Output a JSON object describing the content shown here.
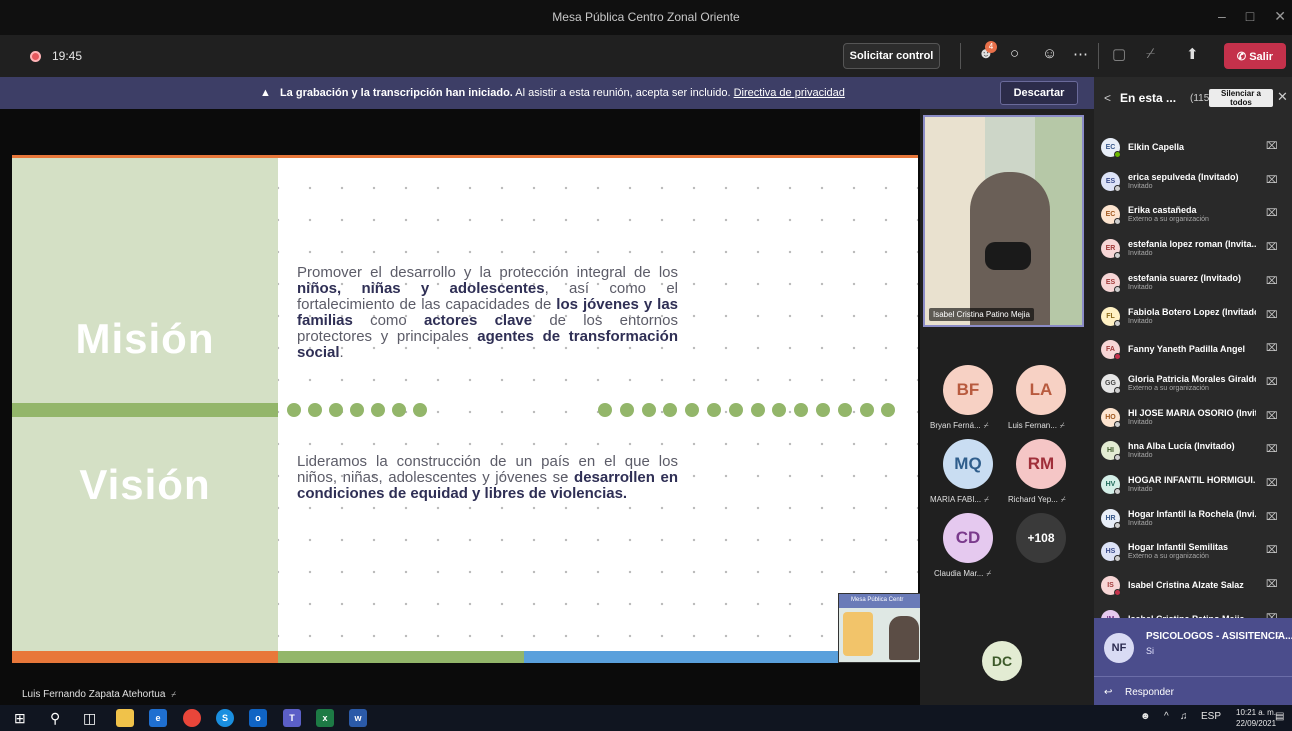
{
  "window": {
    "title": "Mesa Pública Centro Zonal Oriente",
    "controls": [
      "–",
      "□",
      "✕"
    ]
  },
  "toolbar": {
    "timer": "19:45",
    "request_control_label": "Solicitar control",
    "participants_badge": "4",
    "leave_label": "Salir",
    "icons": [
      "people-icon",
      "chat-icon",
      "reactions-icon",
      "more-icon",
      "camera-off-icon",
      "mic-off-icon",
      "share-icon",
      "phone-icon"
    ]
  },
  "banner": {
    "bold_text": "La grabación y la transcripción han iniciado.",
    "text": "Al asistir a esta reunión, acepta ser incluido.",
    "link_text": "Directiva de privacidad",
    "dismiss_label": "Descartar"
  },
  "slide": {
    "mission_title": "Misión",
    "vision_title": "Visión",
    "mission_text_segments": [
      {
        "t": "Promover el desarrollo y la protección integral de los ",
        "b": false
      },
      {
        "t": "niños, niñas y adolescentes",
        "b": true
      },
      {
        "t": ", así como el fortalecimiento de las capacidades de ",
        "b": false
      },
      {
        "t": "los jóvenes y las familias",
        "b": true
      },
      {
        "t": " como ",
        "b": false
      },
      {
        "t": "actores clave",
        "b": true
      },
      {
        "t": " de los entornos protectores y principales ",
        "b": false
      },
      {
        "t": "agentes de transformación social",
        "b": true
      },
      {
        "t": ".",
        "b": false
      }
    ],
    "vision_text_segments": [
      {
        "t": "Lideramos la construcción de un país en el que los niños, niñas, adolescentes y jóvenes se ",
        "b": false
      },
      {
        "t": "desarrollen en condiciones de equidad y libres de violencias.",
        "b": true
      }
    ],
    "colors": {
      "left_panel": "#d4e0c5",
      "green": "#93b66a",
      "orange": "#e8773a",
      "blue": "#5aa0dc"
    }
  },
  "presenter_name": "Luis Fernando Zapata Atehortua",
  "video": {
    "name": "Isabel Cristina Patino Mejia"
  },
  "mini_share": {
    "label": "Mesa Pública Centr"
  },
  "tiles": [
    {
      "initials": "BF",
      "name": "Bryan Ferná...",
      "bg": "#f7d1c4",
      "fg": "#b85a3e"
    },
    {
      "initials": "LA",
      "name": "Luis Fernan...",
      "bg": "#f7d1c4",
      "fg": "#b85a3e"
    },
    {
      "initials": "MQ",
      "name": "MARIA FABI...",
      "bg": "#c9ddf2",
      "fg": "#2f5e8c"
    },
    {
      "initials": "RM",
      "name": "Richard Yep...",
      "bg": "#f5c6c6",
      "fg": "#a02f3a"
    },
    {
      "initials": "CD",
      "name": "Claudia Mar...",
      "bg": "#e5c9ef",
      "fg": "#7a3a8c"
    },
    {
      "initials": "+108",
      "name": "",
      "bg": "#3a3a3a",
      "fg": "#ffffff"
    },
    {
      "initials": "DC",
      "name": "",
      "bg": "#e3ecd3",
      "fg": "#3d5a2a"
    }
  ],
  "panel": {
    "title": "En esta ...",
    "count": "(115)",
    "mute_all_label": "Silenciar a todos",
    "participants": [
      {
        "initials": "EC",
        "name": "Elkin Capella",
        "sub": "",
        "bg": "#e8eef8",
        "fg": "#3a5a8c",
        "status": "#6bb700"
      },
      {
        "initials": "ES",
        "name": "erica sepulveda (Invitado)",
        "sub": "Invitado",
        "bg": "#dde3f7",
        "fg": "#3a4a8c",
        "status": "#cfcfcf"
      },
      {
        "initials": "EC",
        "name": "Erika castañeda",
        "sub": "Externo a su organización",
        "bg": "#fde4cf",
        "fg": "#a25a20",
        "status": "#cfcfcf"
      },
      {
        "initials": "ER",
        "name": "estefania lopez roman (Invita...",
        "sub": "Invitado",
        "bg": "#f7d6d6",
        "fg": "#a13a3a",
        "status": "#cfcfcf"
      },
      {
        "initials": "ES",
        "name": "estefania suarez (Invitado)",
        "sub": "Invitado",
        "bg": "#f7d6d6",
        "fg": "#a13a3a",
        "status": "#cfcfcf"
      },
      {
        "initials": "FL",
        "name": "Fabiola Botero Lopez (Invitado)",
        "sub": "Invitado",
        "bg": "#fff1c4",
        "fg": "#8c6a1a",
        "status": "#cfcfcf"
      },
      {
        "initials": "FA",
        "name": "Fanny Yaneth Padilla Angel",
        "sub": "",
        "bg": "#f7d6d6",
        "fg": "#a13a3a",
        "status": "#c4314b"
      },
      {
        "initials": "GG",
        "name": "Gloria Patricia Morales Giraldo",
        "sub": "Externo a su organización",
        "bg": "#e6e6e6",
        "fg": "#444444",
        "status": "#cfcfcf"
      },
      {
        "initials": "HO",
        "name": "HI JOSE MARIA OSORIO (Invit...",
        "sub": "Invitado",
        "bg": "#fde4cf",
        "fg": "#a25a20",
        "status": "#cfcfcf"
      },
      {
        "initials": "HI",
        "name": "hna Alba Lucía (Invitado)",
        "sub": "Invitado",
        "bg": "#e3ecd3",
        "fg": "#3d5a2a",
        "status": "#cfcfcf"
      },
      {
        "initials": "HV",
        "name": "HOGAR INFANTIL HORMIGUI...",
        "sub": "Invitado",
        "bg": "#d4efe8",
        "fg": "#1e6a5a",
        "status": "#cfcfcf"
      },
      {
        "initials": "HR",
        "name": "Hogar Infantil la Rochela (Invi...",
        "sub": "Invitado",
        "bg": "#e8eef8",
        "fg": "#3a5a8c",
        "status": "#cfcfcf"
      },
      {
        "initials": "HS",
        "name": "Hogar Infantil Semilitas",
        "sub": "Externo a su organización",
        "bg": "#dde3f7",
        "fg": "#3a4a8c",
        "status": "#cfcfcf"
      },
      {
        "initials": "IS",
        "name": "Isabel Cristina Alzate Salaz",
        "sub": "",
        "bg": "#f7d6d6",
        "fg": "#a13a3a",
        "status": "#c4314b"
      },
      {
        "initials": "IM",
        "name": "Isabel Cristina Patino Mejia",
        "sub": "",
        "bg": "#e5c9ef",
        "fg": "#7a3a8c",
        "status": "#6bb700"
      }
    ]
  },
  "chat_toast": {
    "initials": "NF",
    "title": "PSICOLOGOS - ASISITENCIA...",
    "message": "Si",
    "reply_label": "Responder"
  },
  "taskbar": {
    "language": "ESP",
    "time": "10:21 a. m.",
    "date": "22/09/2021",
    "apps": [
      "windows-start",
      "search",
      "task-view",
      "file-explorer",
      "edge",
      "chrome",
      "skype",
      "outlook",
      "teams",
      "excel",
      "word"
    ]
  }
}
